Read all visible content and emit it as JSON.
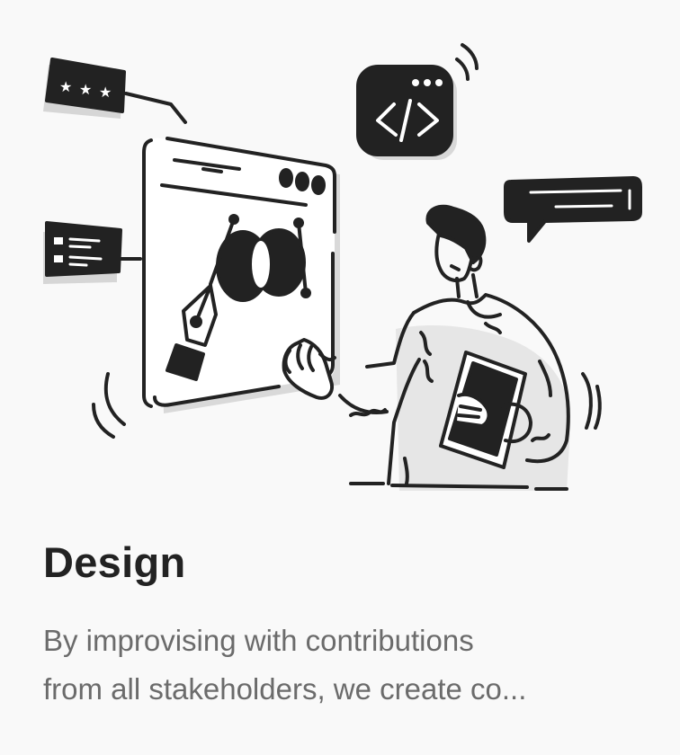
{
  "card": {
    "title": "Design",
    "description": "By improvising with contributions\nfrom all stakeholders, we create co..."
  },
  "illustration": {
    "ink_color": "#222222",
    "shadow_color": "#d8d8d8",
    "icons": [
      "rating-stars-icon",
      "code-tag-icon",
      "chat-bubble-icon",
      "list-card-icon",
      "pen-tool-icon",
      "venn-shape-icon"
    ]
  }
}
